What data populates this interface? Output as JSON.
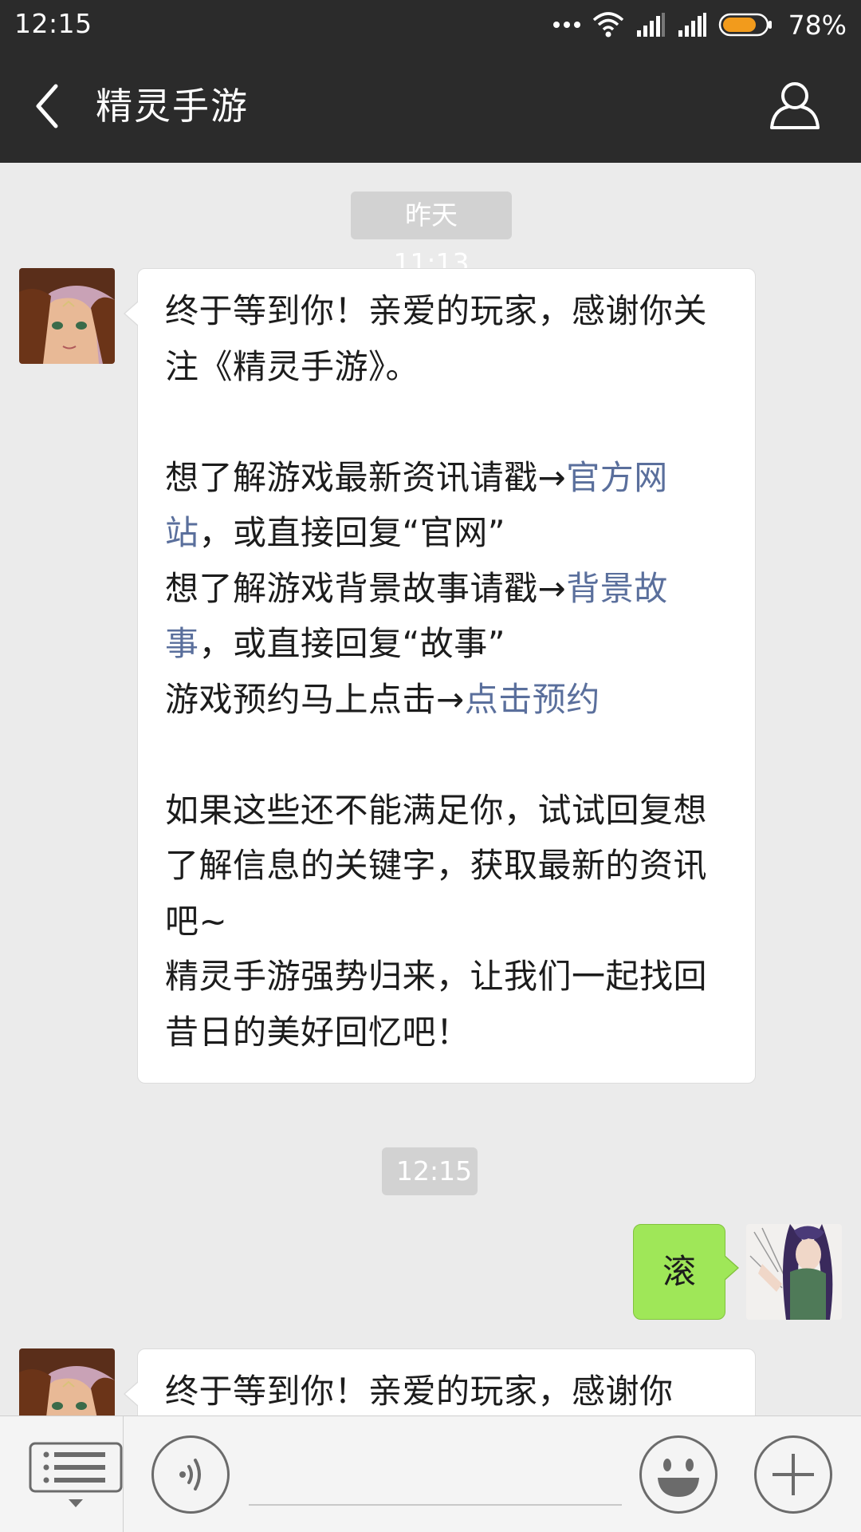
{
  "status_bar": {
    "time": "12:15",
    "battery_percent": "78%",
    "battery_level": 0.78,
    "battery_color": "#f29b1c",
    "icons": [
      "more-dots-icon",
      "wifi-icon",
      "signal-icon",
      "signal-icon",
      "battery-icon"
    ]
  },
  "header": {
    "title": "精灵手游",
    "back_icon": "chevron-left-icon",
    "profile_icon": "person-icon"
  },
  "conversation": {
    "timestamps": [
      "昨天 11:13",
      "12:15"
    ],
    "messages": [
      {
        "sender": "精灵手游",
        "intro": "终于等到你！亲爱的玩家，感谢你关注《精灵手游》。",
        "line1_prefix": "想了解游戏最新资讯请戳→",
        "line1_link": "官方网站",
        "line1_suffix": "，或直接回复“官网”",
        "line2_prefix": "想了解游戏背景故事请戳→",
        "line2_link": "背景故事",
        "line2_suffix": "，或直接回复“故事”",
        "line3_prefix": "游戏预约马上点击→",
        "line3_link": "点击预约",
        "outro1": "如果这些还不能满足你，试试回复想了解信息的关键字，获取最新的资讯吧~",
        "outro2": "精灵手游强势归来，让我们一起找回昔日的美好回忆吧！"
      },
      {
        "sender": "me",
        "text": "滚"
      },
      {
        "sender": "精灵手游",
        "intro": "终于等到你！亲爱的玩家，感谢你"
      }
    ]
  },
  "input_bar": {
    "menu_icon": "list-menu-icon",
    "voice_icon": "voice-icon",
    "emoji_icon": "smiley-icon",
    "plus_icon": "plus-icon",
    "input_value": ""
  },
  "colors": {
    "header_bg": "#2b2b2b",
    "chat_bg": "#ebebeb",
    "sent_bubble": "#9fe758",
    "link": "#5a6f9c"
  }
}
